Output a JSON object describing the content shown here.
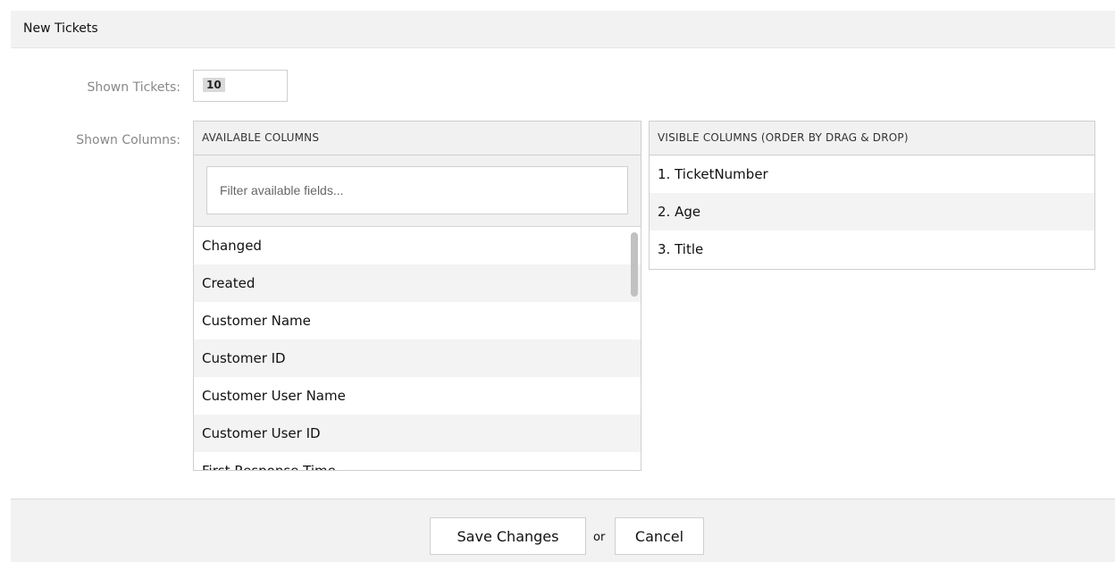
{
  "widget": {
    "title": "New Tickets"
  },
  "form": {
    "shown_tickets_label": "Shown Tickets:",
    "shown_tickets_value": "10",
    "shown_columns_label": "Shown Columns:"
  },
  "available_columns": {
    "header": "AVAILABLE COLUMNS",
    "filter_placeholder": "Filter available fields...",
    "items": [
      "Changed",
      "Created",
      "Customer Name",
      "Customer ID",
      "Customer User Name",
      "Customer User ID",
      "First Response Time"
    ]
  },
  "visible_columns": {
    "header": "VISIBLE COLUMNS (ORDER BY DRAG & DROP)",
    "items": [
      "1. TicketNumber",
      "2. Age",
      "3. Title"
    ]
  },
  "footer": {
    "save_label": "Save Changes",
    "or_label": "or",
    "cancel_label": "Cancel"
  }
}
